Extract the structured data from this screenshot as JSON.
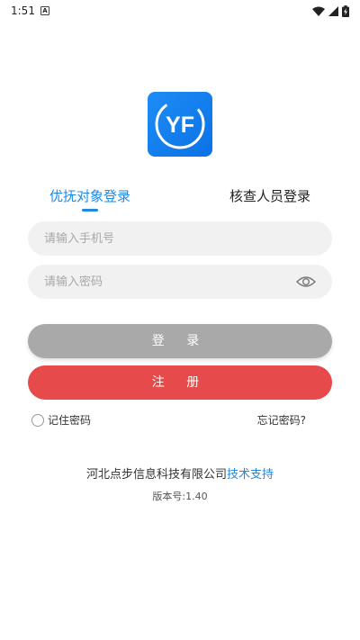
{
  "status_bar": {
    "time": "1:51",
    "notification_icon": "A"
  },
  "logo": {
    "text": "YF"
  },
  "tabs": [
    {
      "label": "优抚对象登录",
      "active": true
    },
    {
      "label": "核查人员登录",
      "active": false
    }
  ],
  "form": {
    "phone_placeholder": "请输入手机号",
    "password_placeholder": "请输入密码"
  },
  "buttons": {
    "login_label": "登 录",
    "register_label": "注 册"
  },
  "options": {
    "remember_label": "记住密码",
    "forgot_label": "忘记密码?"
  },
  "footer": {
    "company": "河北点步信息科技有限公司",
    "support": "技术支持",
    "version": "版本号:1.40"
  },
  "colors": {
    "accent": "#1e88e5",
    "login_button": "#a9a9a9",
    "register_button": "#e64a4a"
  }
}
